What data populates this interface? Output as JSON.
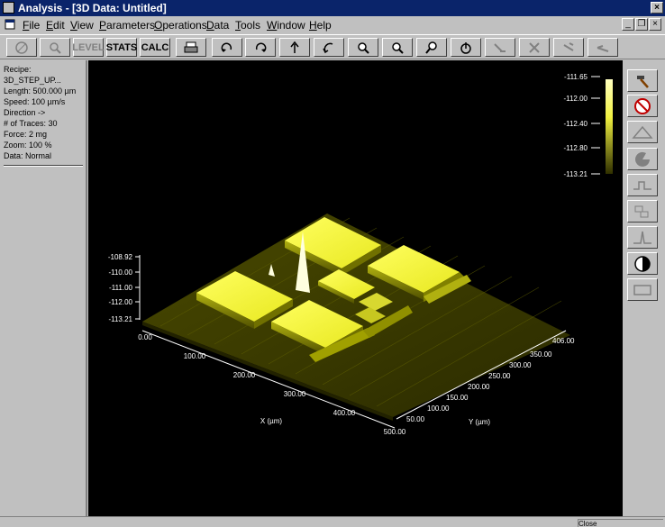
{
  "window": {
    "title": "Analysis - [3D Data: Untitled]"
  },
  "menu": [
    {
      "label": "File",
      "accel": "F"
    },
    {
      "label": "Edit",
      "accel": "E"
    },
    {
      "label": "View",
      "accel": "V"
    },
    {
      "label": "Parameters",
      "accel": "P"
    },
    {
      "label": "Operations",
      "accel": "O"
    },
    {
      "label": "Data",
      "accel": "D"
    },
    {
      "label": "Tools",
      "accel": "T"
    },
    {
      "label": "Window",
      "accel": "W"
    },
    {
      "label": "Help",
      "accel": "H"
    }
  ],
  "toolbar": {
    "level": "LEVEL",
    "stats": "STATS",
    "calc": "CALC",
    "icons": [
      "target-icon",
      "magnifier-icon",
      "printer-icon",
      "rotate-cw-icon",
      "rotate-ccw-icon",
      "tilt-up-icon",
      "tilt-down-icon",
      "zoom-in-icon",
      "zoom-out-icon",
      "zoom-hand-icon",
      "rotate-view-icon",
      "probe-icon",
      "cross-icon",
      "diagonal-icon",
      "flat-icon"
    ]
  },
  "info": {
    "recipe_label": "Recipe:",
    "recipe": "3D_STEP_UP...",
    "length": "Length: 500.000 µm",
    "speed": "Speed: 100 µm/s",
    "direction": "Direction ->",
    "traces": "# of Traces: 30",
    "force": "Force: 2 mg",
    "zoom": "Zoom: 100 %",
    "data": "Data: Normal"
  },
  "colorbar": {
    "labels": [
      "-111.65",
      "-112.00",
      "-112.40",
      "-112.80",
      "-113.21"
    ]
  },
  "z_axis": {
    "labels": [
      "-108.92",
      "-110.00",
      "-111.00",
      "-112.00",
      "-113.21"
    ]
  },
  "x_axis": {
    "label": "X (µm)",
    "ticks": [
      "0.00",
      "100.00",
      "200.00",
      "300.00",
      "400.00",
      "500.00"
    ]
  },
  "y_axis": {
    "label": "Y (µm)",
    "ticks": [
      "50.00",
      "100.00",
      "150.00",
      "200.00",
      "250.00",
      "300.00",
      "350.00",
      "406.00"
    ]
  },
  "right_tools": [
    "hammer-icon",
    "no-hammer-icon",
    "triangle-icon",
    "pie-icon",
    "step-height-icon",
    "dimension-icon",
    "peak-icon",
    "contrast-icon",
    "rectangle-icon"
  ],
  "colors": {
    "surface": "#e8e840",
    "background": "#000000",
    "chrome": "#c0c0c0",
    "title": "#0a246a"
  },
  "status": {
    "text": "Close"
  }
}
